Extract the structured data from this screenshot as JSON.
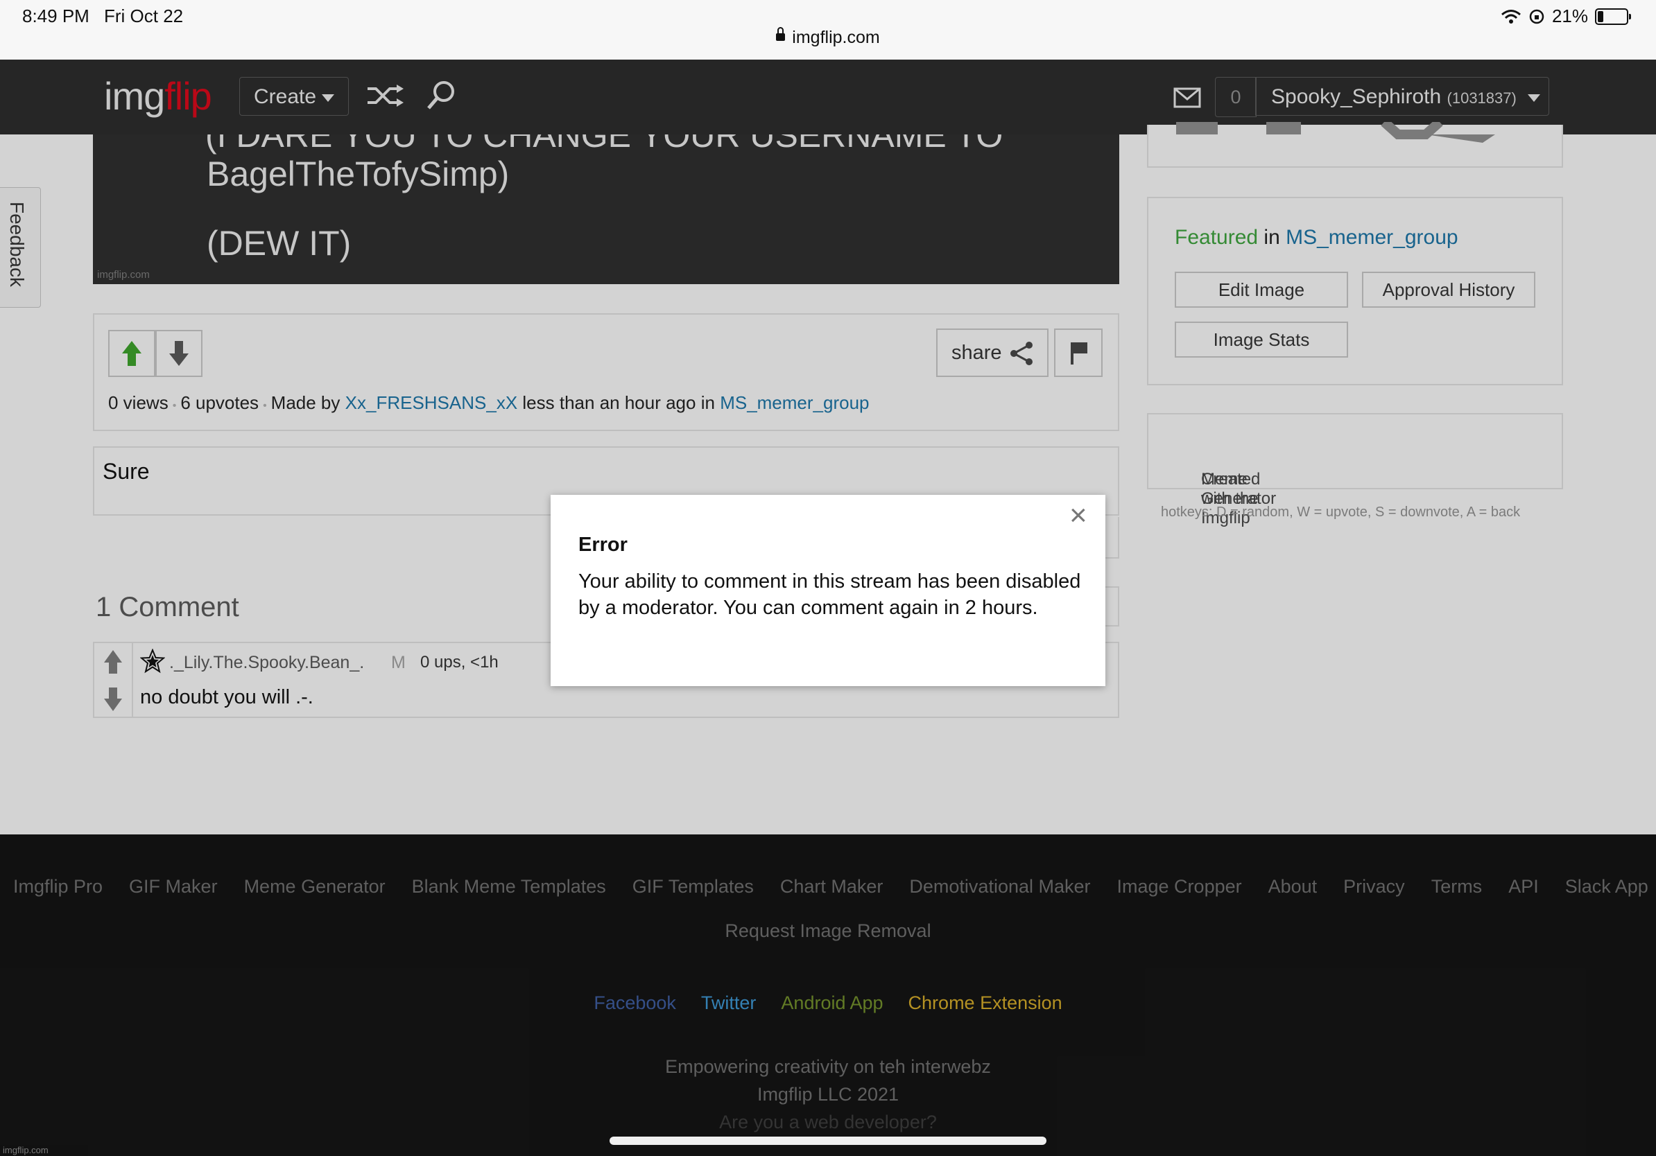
{
  "status_bar": {
    "time": "8:49 PM",
    "date": "Fri Oct 22",
    "url": "imgflip.com",
    "battery": "21%"
  },
  "header": {
    "logo_part1": "img",
    "logo_part2": "flip",
    "create_label": "Create",
    "notification_count": "0",
    "username": "Spooky_Sephiroth",
    "user_points": "(1031837)"
  },
  "feedback_tab": "Feedback",
  "meme": {
    "cut_line": "(I DARE YOU TO CHANGE YOUR USERNAME TO",
    "line1": "BagelTheTofySimp)",
    "line2": "(DEW IT)",
    "watermark": "imgflip.com"
  },
  "info": {
    "share_label": "share",
    "views": "0 views",
    "upvotes": "6 upvotes",
    "made_by_prefix": "Made by",
    "author": "Xx_FRESHSANS_xX",
    "time_text": "less than an hour ago in",
    "stream": "MS_memer_group"
  },
  "caption": "Sure",
  "comments": {
    "title": "1 Comment",
    "items": [
      {
        "user": "._Lily.The.Spooky.Bean_.",
        "badge": "M",
        "meta": "0 ups, <1h",
        "text": "no doubt you will .-."
      }
    ]
  },
  "sidebar": {
    "featured_word": "Featured",
    "in_word": "in",
    "group": "MS_memer_group",
    "edit_image": "Edit Image",
    "approval_history": "Approval History",
    "image_stats": "Image Stats",
    "created_prefix": "Created with the Imgflip",
    "created_link": "Meme Generator",
    "hotkeys": "hotkeys: D = random, W = upvote, S = downvote, A = back"
  },
  "footer": {
    "links": [
      "Imgflip Pro",
      "GIF Maker",
      "Meme Generator",
      "Blank Meme Templates",
      "GIF Templates",
      "Chart Maker",
      "Demotivational Maker",
      "Image Cropper",
      "About",
      "Privacy",
      "Terms",
      "API",
      "Slack App"
    ],
    "request_removal": "Request Image Removal",
    "social": [
      {
        "label": "Facebook",
        "color": "#3b5998"
      },
      {
        "label": "Twitter",
        "color": "#3a8fc8"
      },
      {
        "label": "Android App",
        "color": "#6e8a2a"
      },
      {
        "label": "Chrome Extension",
        "color": "#c9a227"
      }
    ],
    "tagline": "Empowering creativity on teh interwebz",
    "company": "Imgflip LLC 2021",
    "developer": "Are you a web developer?",
    "corner_watermark": "imgflip.com"
  },
  "modal": {
    "close": "×",
    "title": "Error",
    "message": "Your ability to comment in this stream has been disabled by a moderator. You can comment again in 2 hours."
  }
}
